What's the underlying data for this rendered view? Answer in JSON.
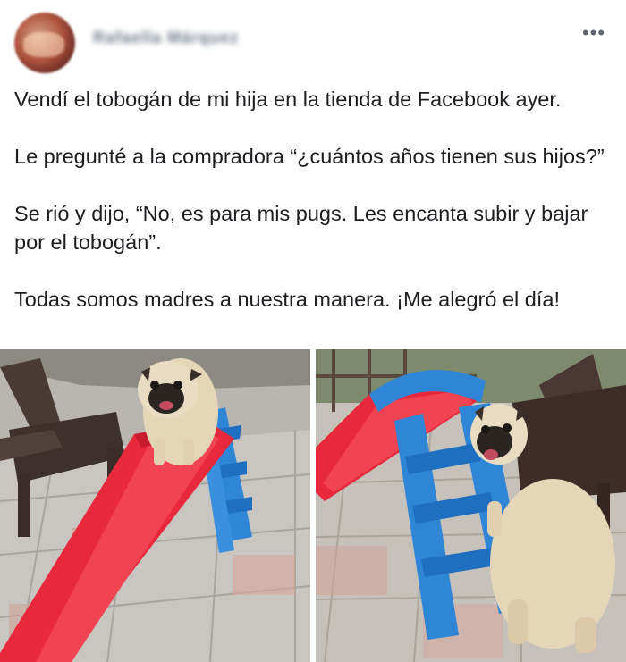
{
  "post": {
    "author_name": "Rafaella Márquez",
    "more_options_icon": "ellipsis-icon",
    "more_options_label": "•••",
    "paragraphs": [
      "Vendí el tobogán de mi hija en la tienda de Facebook ayer.",
      "Le pregunté a la compradora “¿cuántos años tienen sus hijos?”",
      "Se rió y dijo, “No, es para mis pugs. Les encanta subir y bajar por el tobogán”.",
      "Todas somos madres a nuestra manera. ¡Me alegró el día!"
    ]
  },
  "photos": {
    "left": "pug-on-slide-photo",
    "right": "pug-next-to-slide-photo"
  },
  "colors": {
    "text": "#1c1e21",
    "slide_red": "#e8283b",
    "slide_blue": "#2f86d6",
    "pug_fawn": "#e6d6b8"
  }
}
